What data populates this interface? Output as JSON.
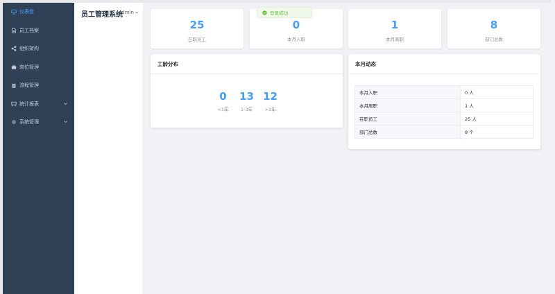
{
  "app": {
    "brand": "员工管理系统",
    "user": "admin"
  },
  "sidebar": {
    "items": [
      {
        "label": "仪表盘",
        "icon": "monitor-icon",
        "active": true
      },
      {
        "label": "员工档案",
        "icon": "document-icon",
        "active": false
      },
      {
        "label": "组织架构",
        "icon": "share-icon",
        "active": false
      },
      {
        "label": "岗位管理",
        "icon": "briefcase-icon",
        "active": false
      },
      {
        "label": "流程管理",
        "icon": "clipboard-icon",
        "active": false
      },
      {
        "label": "统计报表",
        "icon": "presentation-icon",
        "active": false,
        "expandable": true
      },
      {
        "label": "系统管理",
        "icon": "gear-icon",
        "active": false,
        "expandable": true
      }
    ]
  },
  "toast": {
    "text": "登录成功"
  },
  "stats": [
    {
      "value": "25",
      "label": "在职员工"
    },
    {
      "value": "0",
      "label": "本月入职"
    },
    {
      "value": "1",
      "label": "本月离职"
    },
    {
      "value": "8",
      "label": "部门总数"
    }
  ],
  "tenure": {
    "title": "工龄分布",
    "items": [
      {
        "value": "0",
        "label": "<1年"
      },
      {
        "value": "13",
        "label": "1-3年"
      },
      {
        "value": "12",
        "label": ">3年"
      }
    ]
  },
  "monthly": {
    "title": "本月动态",
    "rows": [
      {
        "key": "本月入职",
        "value": "0 人"
      },
      {
        "key": "本月离职",
        "value": "1 人"
      },
      {
        "key": "在职员工",
        "value": "25 人"
      },
      {
        "key": "部门总数",
        "value": "8 个"
      }
    ]
  },
  "colors": {
    "sidebar": "#304156",
    "accent": "#409eff",
    "success": "#67c23a"
  }
}
